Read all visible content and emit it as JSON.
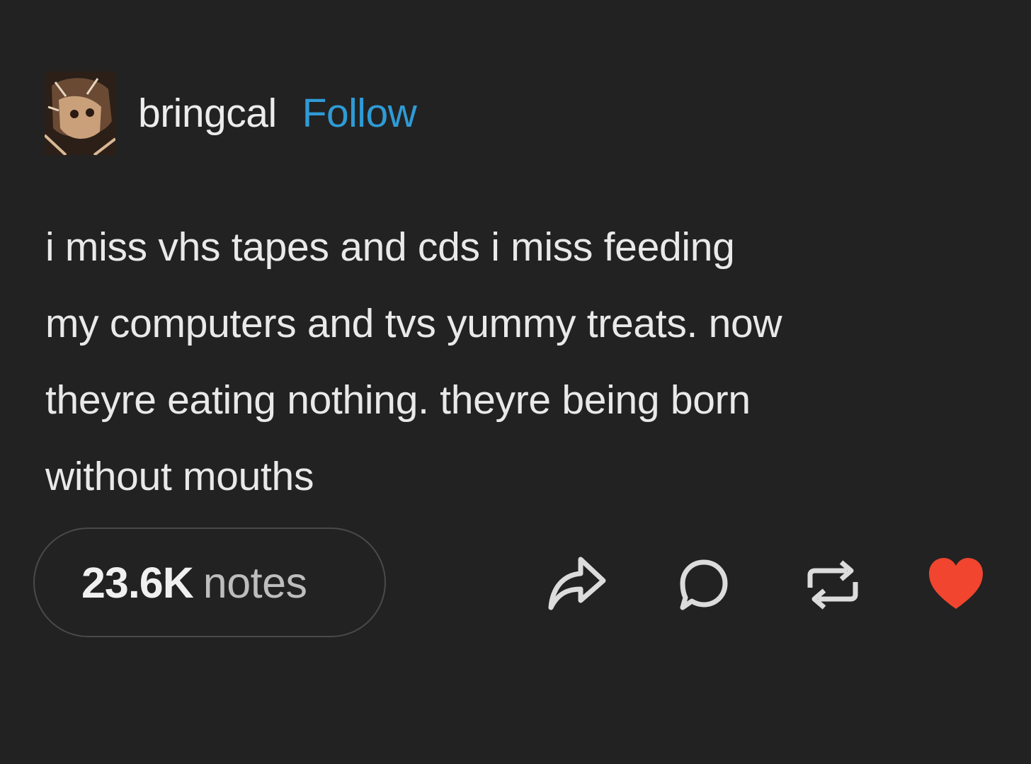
{
  "post": {
    "username": "bringcal",
    "follow_label": "Follow",
    "body": "i miss vhs tapes and cds i miss feeding\nmy computers and tvs yummy treats. now\ntheyre eating nothing. theyre being born\nwithout mouths",
    "notes_count": "23.6K",
    "notes_label": "notes"
  },
  "actions": {
    "share_icon": "share-icon",
    "reply_icon": "reply-icon",
    "reblog_icon": "reblog-icon",
    "like_icon": "heart-icon",
    "liked": true
  },
  "colors": {
    "background": "#222222",
    "follow": "#2f9bd6",
    "heart": "#f1452f",
    "text": "#e9e9e9"
  }
}
